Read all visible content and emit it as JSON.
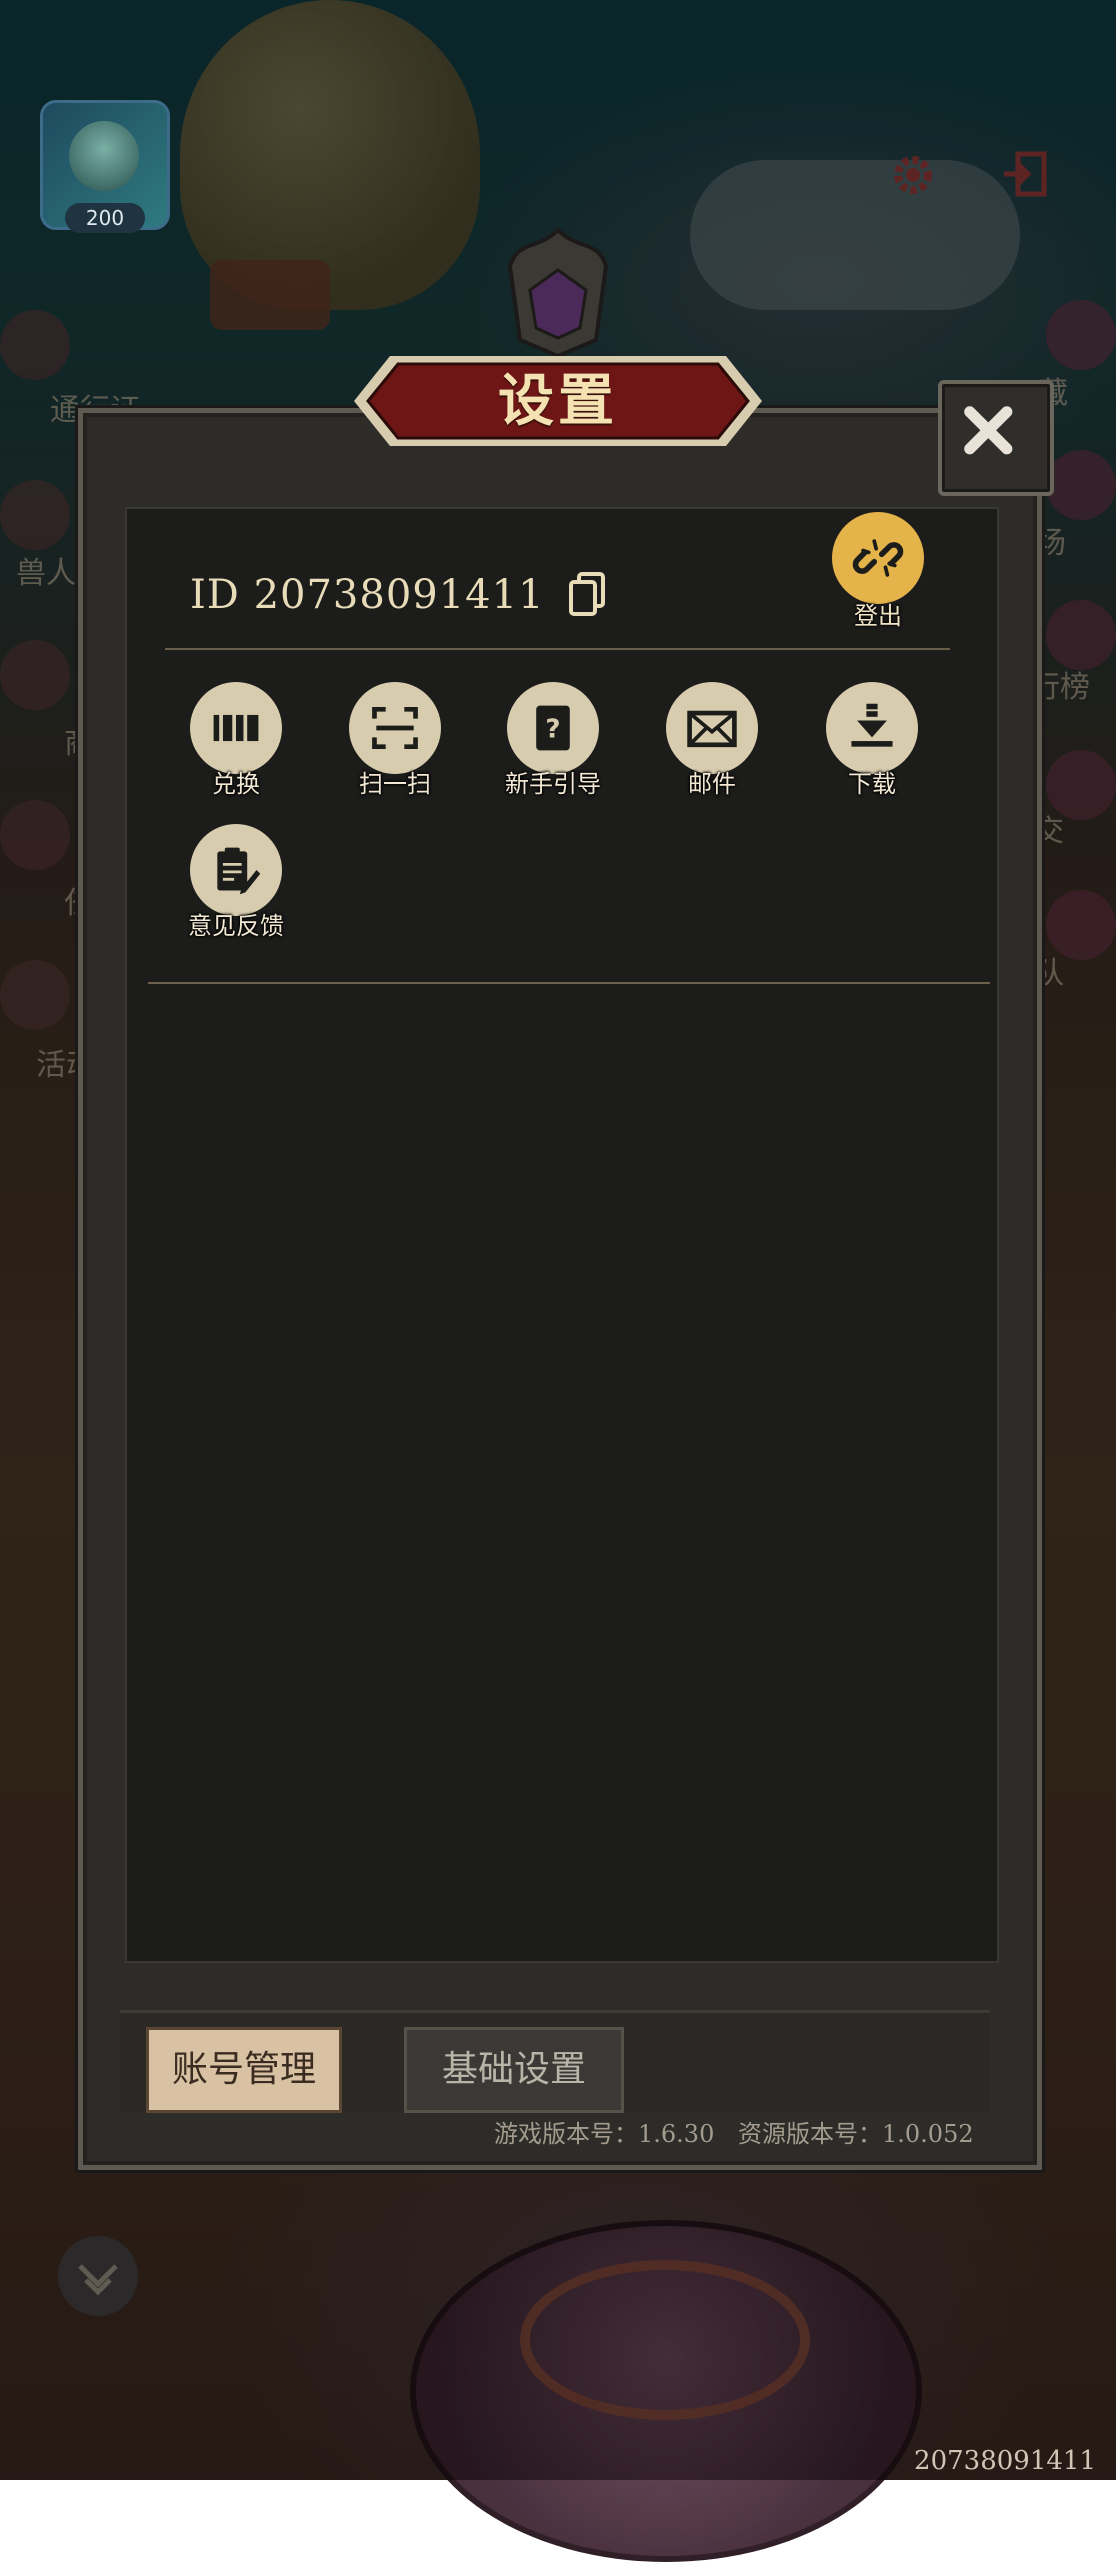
{
  "dialog": {
    "title": "设置",
    "user_id": "ID 20738091411",
    "logout_label": "登出",
    "actions": [
      {
        "label": "兑换",
        "icon": "barcode-icon"
      },
      {
        "label": "扫一扫",
        "icon": "scan-icon"
      },
      {
        "label": "新手引导",
        "icon": "guide-book-icon"
      },
      {
        "label": "邮件",
        "icon": "mail-icon"
      },
      {
        "label": "下载",
        "icon": "download-icon"
      },
      {
        "label": "意见反馈",
        "icon": "feedback-clipboard-icon"
      }
    ],
    "tabs": [
      {
        "label": "账号管理",
        "active": true
      },
      {
        "label": "基础设置",
        "active": false
      }
    ],
    "game_version": "游戏版本号：1.6.30",
    "resource_version": "资源版本号：1.0.052"
  },
  "hud": {
    "avatar_level": "200",
    "bottom_user_id": "20738091411"
  },
  "background_side_labels": {
    "left": [
      "通行证",
      "兽人",
      "商",
      "任",
      "活动"
    ],
    "right": [
      "藏",
      "场",
      "行榜",
      "交",
      "队"
    ]
  },
  "colors": {
    "panel_bg": "#1c1c1b",
    "title_plate": "#7a1a1a",
    "accent_gold": "#e4b34a",
    "icon_circle": "#d8ccae",
    "tab_active": "#d9c2a4"
  }
}
